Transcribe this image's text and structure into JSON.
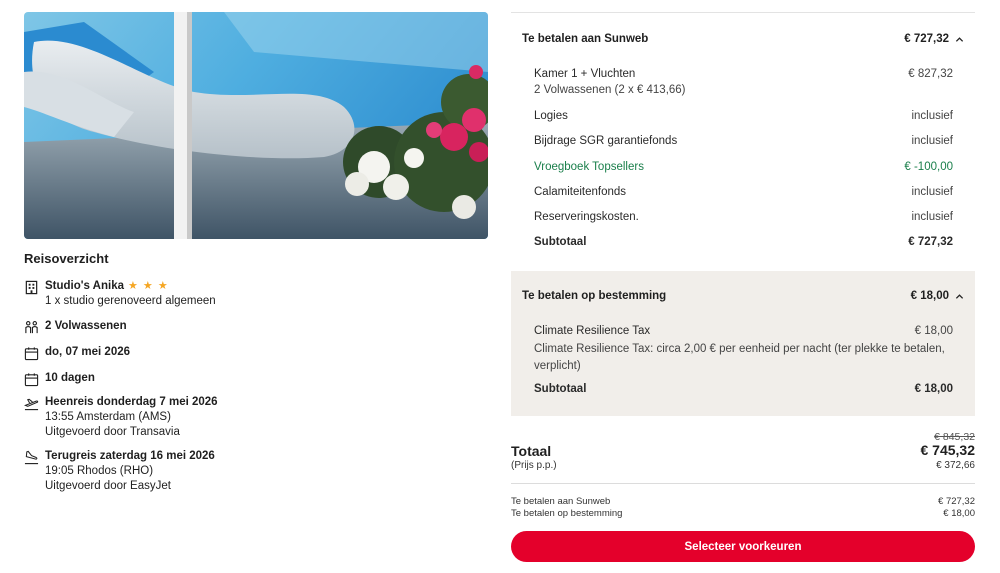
{
  "overview": {
    "title": "Reisoverzicht",
    "hotel": {
      "name": "Studio's Anika",
      "stars": "★ ★ ★",
      "room": "1 x studio gerenoveerd algemeen"
    },
    "travellers": "2 Volwassenen",
    "date": "do, 07 mei 2026",
    "duration": "10 dagen",
    "outbound": {
      "title": "Heenreis donderdag 7 mei 2026",
      "time": "13:55 Amsterdam (AMS)",
      "carrier": "Uitgevoerd door Transavia"
    },
    "return": {
      "title": "Terugreis zaterdag 16 mei 2026",
      "time": "19:05 Rhodos (RHO)",
      "carrier": "Uitgevoerd door EasyJet"
    },
    "icons": {
      "hotel": "building-icon",
      "people": "people-icon",
      "calendar": "calendar-icon",
      "departure": "plane-departure-icon",
      "arrival": "plane-arrival-icon"
    }
  },
  "sunweb": {
    "header": "Te betalen aan Sunweb",
    "header_amount": "€ 727,32",
    "room_label": "Kamer 1 + Vluchten",
    "room_value": "€ 827,32",
    "room_sub": "2 Volwassenen (2 x € 413,66)",
    "lines": [
      {
        "label": "Logies",
        "value": "inclusief"
      },
      {
        "label": "Bijdrage SGR garantiefonds",
        "value": "inclusief"
      },
      {
        "label": "Vroegboek Topsellers",
        "value": "€ -100,00"
      },
      {
        "label": "Calamiteitenfonds",
        "value": "inclusief"
      },
      {
        "label": "Reserveringskosten.",
        "value": "inclusief"
      }
    ],
    "subtotal_label": "Subtotaal",
    "subtotal_value": "€ 727,32"
  },
  "destination": {
    "header": "Te betalen op bestemming",
    "header_amount": "€ 18,00",
    "tax_label": "Climate Resilience Tax",
    "tax_value": "€ 18,00",
    "tax_note": "Climate Resilience Tax: circa 2,00 € per eenheid per nacht (ter plekke te betalen, verplicht)",
    "subtotal_label": "Subtotaal",
    "subtotal_value": "€ 18,00"
  },
  "total": {
    "old_price": "€ 845,32",
    "label": "Totaal",
    "value": "€ 745,32",
    "pp_label": "(Prijs p.p.)",
    "pp_value": "€ 372,66",
    "sunweb_label": "Te betalen aan Sunweb",
    "sunweb_value": "€ 727,32",
    "dest_label": "Te betalen op bestemming",
    "dest_value": "€ 18,00"
  },
  "cta": {
    "label": "Selecteer voorkeuren"
  },
  "colors": {
    "accent": "#e4002b",
    "discount": "#1a7f4b",
    "star": "#f5a623",
    "panel": "#f1eeea"
  }
}
